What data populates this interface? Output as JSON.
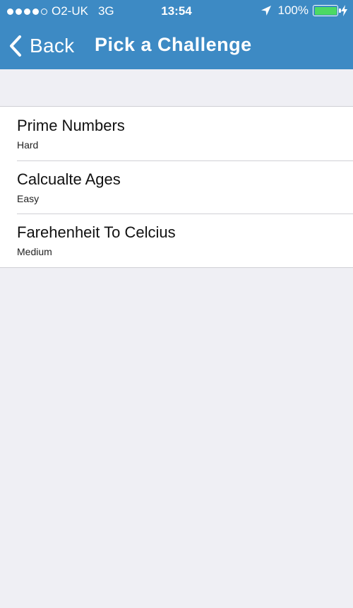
{
  "status_bar": {
    "carrier": "O2-UK",
    "network": "3G",
    "time": "13:54",
    "battery_percent": "100%",
    "signal_strength": 4,
    "signal_max": 5,
    "icons": [
      "location-arrow-icon",
      "battery-icon",
      "charging-bolt-icon"
    ],
    "battery_color": "#4cd964"
  },
  "nav": {
    "back_label": "Back",
    "title": "Pick a Challenge",
    "background_color": "#3d8ac4"
  },
  "challenges": [
    {
      "title": "Prime Numbers",
      "difficulty": "Hard"
    },
    {
      "title": "Calcualte Ages",
      "difficulty": "Easy"
    },
    {
      "title": "Farehenheit To Celcius",
      "difficulty": "Medium"
    }
  ]
}
